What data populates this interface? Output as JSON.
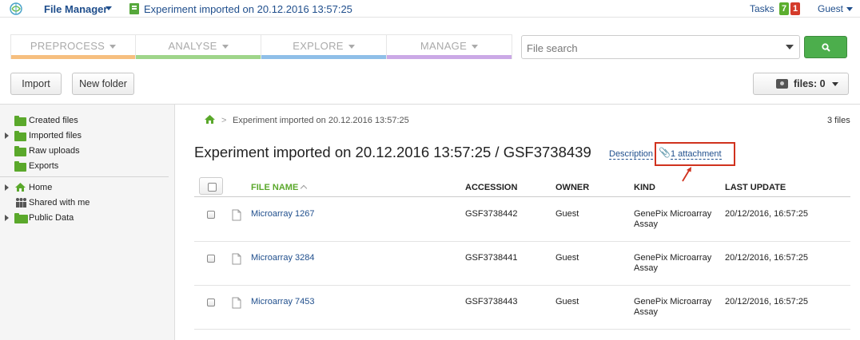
{
  "topbar": {
    "app_title": "File Manager",
    "experiment_title": "Experiment imported on 20.12.2016 13:57:25",
    "tasks_label": "Tasks",
    "tasks_green": "7",
    "tasks_red": "1",
    "user": "Guest"
  },
  "nav": {
    "tabs": [
      {
        "label": "PREPROCESS",
        "color": "#f6bf7f"
      },
      {
        "label": "ANALYSE",
        "color": "#9fd58a"
      },
      {
        "label": "EXPLORE",
        "color": "#8fbfe8"
      },
      {
        "label": "MANAGE",
        "color": "#cba9e6"
      }
    ]
  },
  "search": {
    "placeholder": "File search"
  },
  "toolbar": {
    "import_label": "Import",
    "new_folder_label": "New folder",
    "files_label": "files: 0"
  },
  "sidebar": {
    "items": [
      {
        "label": "Created files"
      },
      {
        "label": "Imported files"
      },
      {
        "label": "Raw uploads"
      },
      {
        "label": "Exports"
      },
      {
        "label": "Home"
      },
      {
        "label": "Shared with me"
      },
      {
        "label": "Public Data"
      }
    ]
  },
  "breadcrumb": {
    "separator": ">",
    "current": "Experiment imported on 20.12.2016 13:57:25"
  },
  "file_count": "3 files",
  "experiment": {
    "heading": "Experiment imported on 20.12.2016 13:57:25 / GSF3738439",
    "description_link": "Description",
    "attachment_link": "1 attachment"
  },
  "table": {
    "columns": [
      "FILE NAME",
      "ACCESSION",
      "OWNER",
      "KIND",
      "LAST UPDATE"
    ],
    "rows": [
      {
        "name": "Microarray 1267",
        "accession": "GSF3738442",
        "owner": "Guest",
        "kind": "GenePix Microarray Assay",
        "updated": "20/12/2016, 16:57:25"
      },
      {
        "name": "Microarray 3284",
        "accession": "GSF3738441",
        "owner": "Guest",
        "kind": "GenePix Microarray Assay",
        "updated": "20/12/2016, 16:57:25"
      },
      {
        "name": "Microarray 7453",
        "accession": "GSF3738443",
        "owner": "Guest",
        "kind": "GenePix Microarray Assay",
        "updated": "20/12/2016, 16:57:25"
      }
    ]
  },
  "icons": {
    "logo": "genestack-logo-icon",
    "experiment": "experiment-icon",
    "search": "search-icon",
    "files": "camera-icon",
    "home": "home-icon",
    "shared": "people-icon",
    "folder": "folder-icon",
    "attachment": "paperclip-icon",
    "file": "document-icon"
  }
}
